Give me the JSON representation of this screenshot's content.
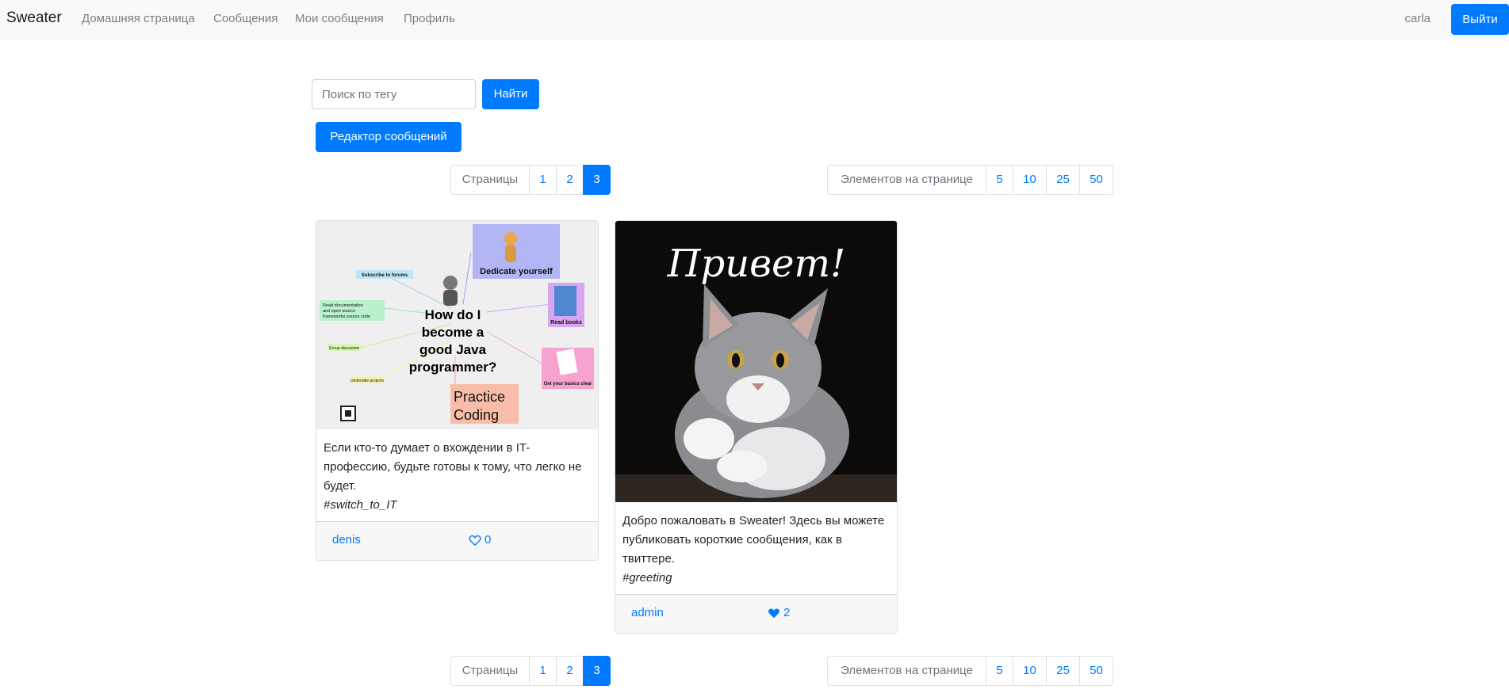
{
  "navbar": {
    "brand": "Sweater",
    "items": [
      {
        "label": "Домашняя страница"
      },
      {
        "label": "Сообщения"
      },
      {
        "label": "Мои сообщения"
      },
      {
        "label": "Профиль"
      }
    ],
    "username": "carla",
    "logout_label": "Выйти"
  },
  "search": {
    "placeholder": "Поиск по тегу",
    "button_label": "Найти"
  },
  "editor_button_label": "Редактор сообщений",
  "pagination": {
    "pages_label": "Страницы",
    "pages": [
      "1",
      "2",
      "3"
    ],
    "current_page": "3",
    "per_page_label": "Элементов на странице",
    "per_page_options": [
      "5",
      "10",
      "25",
      "50"
    ]
  },
  "messages": [
    {
      "image_texts": {
        "title": "How do I become a good Java programmer?",
        "dedicate": "Dedicate yourself",
        "read_books": "Read books",
        "basics": "Get your basics clear",
        "practice": "Practice Coding",
        "forums": "Subscribe to forums",
        "docs": "Read documentation and open source frameworks source code",
        "discussion": "Group discussion",
        "projects": "Undertake projects"
      },
      "text": "Если кто-то думает о вхождении в IT-профессию, будьте готовы к тому, что легко не будет.",
      "tag": "#switch_to_IT",
      "author": "denis",
      "likes": "0",
      "liked": false
    },
    {
      "image_texts": {
        "greeting": "Привет!"
      },
      "text": "Добро пожаловать в Sweater! Здесь вы можете публиковать короткие сообщения, как в твиттере.",
      "tag": "#greeting",
      "author": "admin",
      "likes": "2",
      "liked": true
    }
  ],
  "colors": {
    "primary": "#007bff",
    "navbar_bg": "#f8f9fa",
    "card_footer_bg": "#f7f7f7"
  }
}
